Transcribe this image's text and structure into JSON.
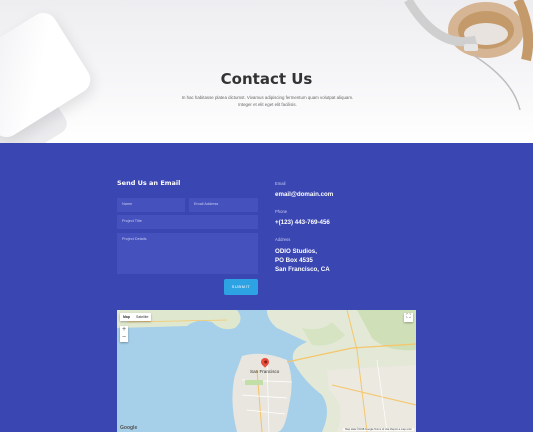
{
  "hero": {
    "title": "Contact Us",
    "subtitle": "In hac habitasse platea dictumst. Vivamus adipiscing fermentum quam volutpat aliquam. Integer et elit eget elit facilisis."
  },
  "form": {
    "title": "Send Us an Email",
    "name_placeholder": "Name",
    "email_placeholder": "Email Address",
    "project_title_placeholder": "Project Title",
    "project_details_placeholder": "Project Details",
    "submit_label": "SUBMIT"
  },
  "info": {
    "email_label": "Email",
    "email_value": "email@domain.com",
    "phone_label": "Phone",
    "phone_value": "+(123) 443-769-456",
    "address_label": "Address",
    "address_line1": "ODIO Studios,",
    "address_line2": "PO Box 4535",
    "address_line3": "San Francisco, CA"
  },
  "map": {
    "type_map": "Map",
    "type_satellite": "Satellite",
    "zoom_in": "+",
    "zoom_out": "−",
    "fullscreen": "⛶",
    "city_label": "San Francisco",
    "google_label": "Google",
    "terms": "Map data ©2018 Google   Terms of Use   Report a map error"
  },
  "colors": {
    "section_bg": "#3a46b2",
    "field_bg": "#4551bd",
    "submit_bg": "#2ea3e4"
  }
}
